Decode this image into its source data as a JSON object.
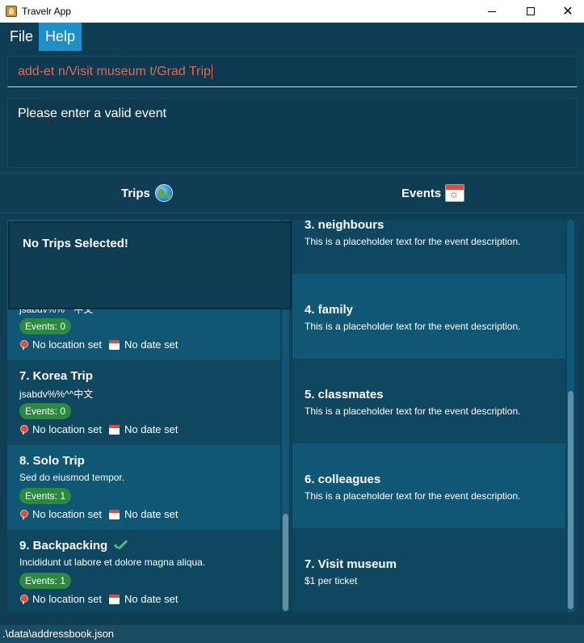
{
  "window": {
    "title": "Travelr App"
  },
  "menu": {
    "file": "File",
    "help": "Help"
  },
  "command": {
    "value": "add-et n/Visit museum t/Grad Trip"
  },
  "result": {
    "message": "Please enter a valid event"
  },
  "headers": {
    "trips": "Trips",
    "trips_icon": "globe-icon",
    "events": "Events",
    "events_icon": "calendar-icon"
  },
  "popup": {
    "text": "No Trips Selected!"
  },
  "trips": [
    {
      "desc": "jsabdv%%^^中文",
      "events_badge": "Events: 0",
      "location": "No location set",
      "date": "No date set"
    },
    {
      "title": "7.  Korea Trip",
      "desc": "jsabdv%%^^中文",
      "events_badge": "Events: 0",
      "location": "No location set",
      "date": "No date set"
    },
    {
      "title": "8.  Solo Trip",
      "desc": "Sed do eiusmod tempor.",
      "events_badge": "Events: 1",
      "location": "No location set",
      "date": "No date set"
    },
    {
      "title": "9.  Backpacking",
      "desc": "Incididunt ut labore et dolore magna aliqua.",
      "events_badge": "Events: 1",
      "location": "No location set",
      "date": "No date set",
      "completed": true
    }
  ],
  "events": [
    {
      "title": "3.  neighbours",
      "desc": "This is a placeholder text for the event description."
    },
    {
      "title": "4.  family",
      "desc": "This is a placeholder text for the event description."
    },
    {
      "title": "5.  classmates",
      "desc": "This is a placeholder text for the event description."
    },
    {
      "title": "6.  colleagues",
      "desc": "This is a placeholder text for the event description."
    },
    {
      "title": "7.  Visit museum",
      "desc": "$1 per ticket"
    }
  ],
  "status": {
    "path": ".\\data\\addressbook.json"
  },
  "colors": {
    "background": "#0e3d54",
    "accent": "#1d91c7",
    "badge": "#2b8a3e",
    "command_text": "#e06a52"
  }
}
